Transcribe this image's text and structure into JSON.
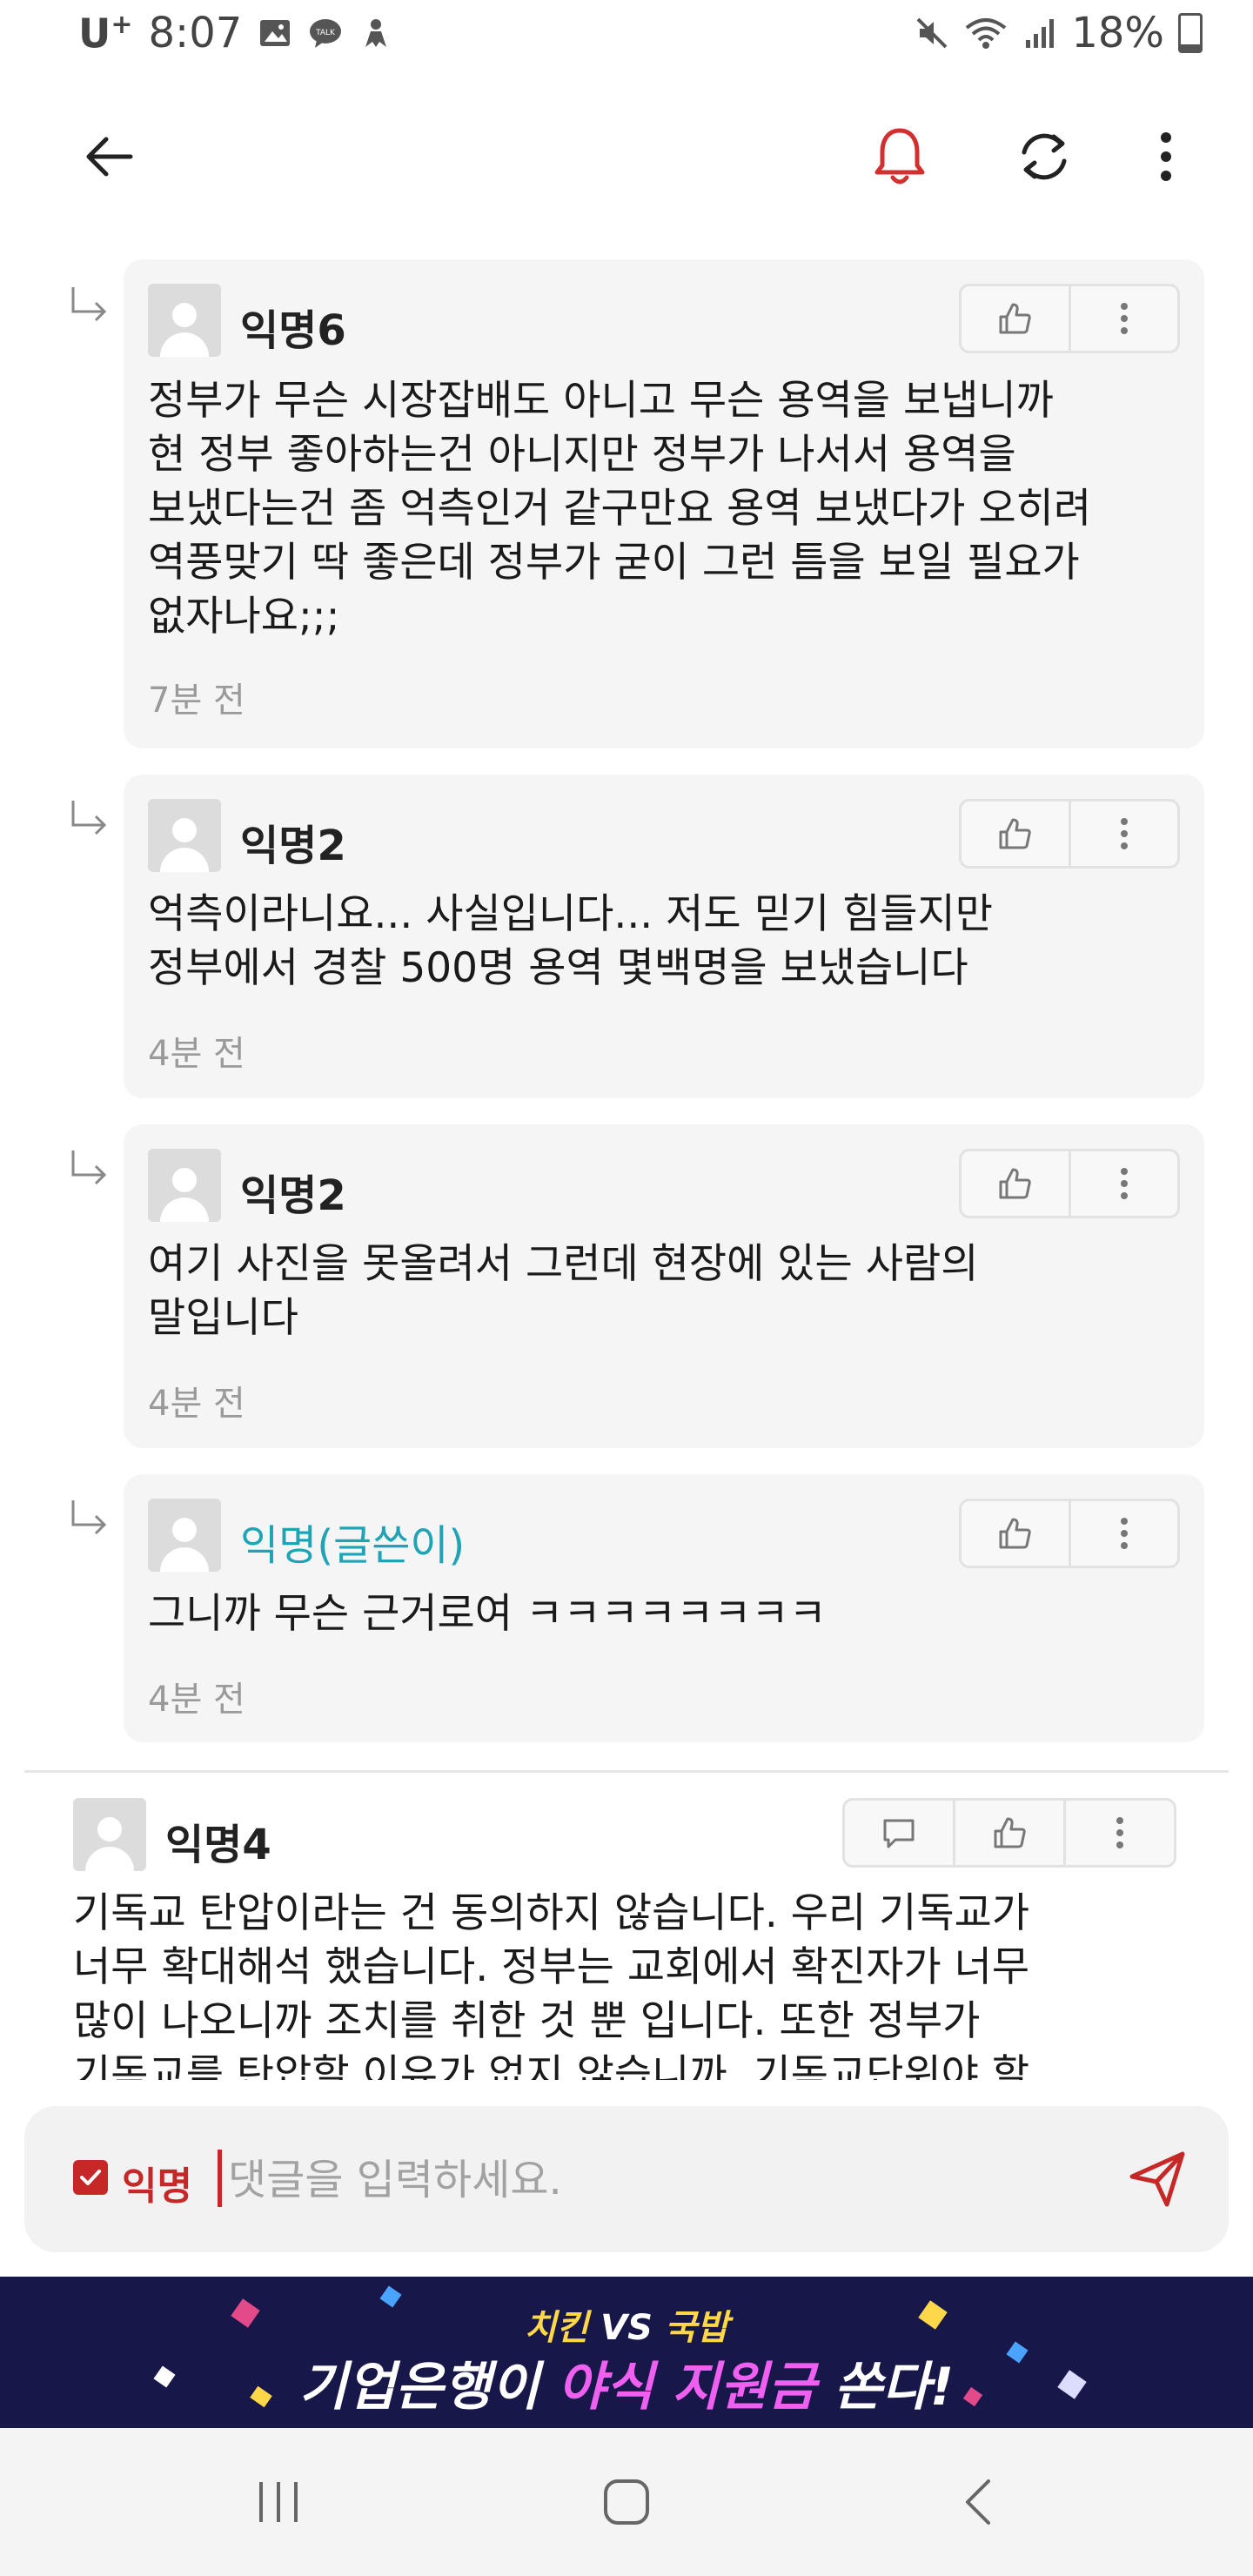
{
  "status_bar": {
    "carrier": "U",
    "carrier_sup": "+",
    "time": "8:07",
    "battery": "18%",
    "icons": [
      "image-icon",
      "talk-icon",
      "app-icon",
      "mute-icon",
      "wifi-icon",
      "signal-icon",
      "battery-icon"
    ]
  },
  "toolbar": {
    "icons": [
      "back-arrow-icon",
      "bell-icon",
      "refresh-icon",
      "more-vertical-icon"
    ],
    "accent": "#d32f2f"
  },
  "comments": [
    {
      "author": "익명6",
      "text": "정부가 무슨 시장잡배도 아니고 무슨 용역을 보냅니까\n현 정부 좋아하는건 아니지만 정부가 나서서 용역을\n보냈다는건 좀 억측인거 같구만요 용역 보냈다가 오히려\n역풍맞기 딱 좋은데 정부가 굳이 그런 틈을 보일 필요가\n없자나요;;;",
      "time": "7분 전"
    },
    {
      "author": "익명2",
      "text": "억측이라니요... 사실입니다... 저도 믿기 힘들지만\n정부에서 경찰 500명 용역 몇백명을 보냈습니다",
      "time": "4분 전"
    },
    {
      "author": "익명2",
      "text": "여기 사진을 못올려서 그런데 현장에 있는 사람의\n말입니다",
      "time": "4분 전"
    },
    {
      "author": "익명(글쓴이)",
      "text": "그니까 무슨 근거로여 ㅋㅋㅋㅋㅋㅋㅋㅋ",
      "time": "4분 전"
    }
  ],
  "top_comment": {
    "author": "익명4",
    "text": "기독교 탄압이라는 건 동의하지 않습니다. 우리 기독교가\n너무 확대해석 했습니다. 정부는 교회에서 확진자가 너무\n많이 나오니까 조치를 취한 것 뿐 입니다. 또한 정부가\n기독교를 탄압할 이유가 없지 않습니까. 기독교단위야 할"
  },
  "input": {
    "anonymous_label": "익명",
    "anonymous_checked": true,
    "placeholder": "댓글을 입력하세요."
  },
  "ad": {
    "line1_a": "치킨",
    "line1_b": " VS ",
    "line1_c": "국밥",
    "line2_a": "기업은행이 ",
    "line2_b": "야식 지원금",
    "line2_c": " 쏜다!"
  },
  "colors": {
    "op_author": "#1fa3b5",
    "accent_red": "#c62828",
    "ad_bg": "#17174a"
  }
}
